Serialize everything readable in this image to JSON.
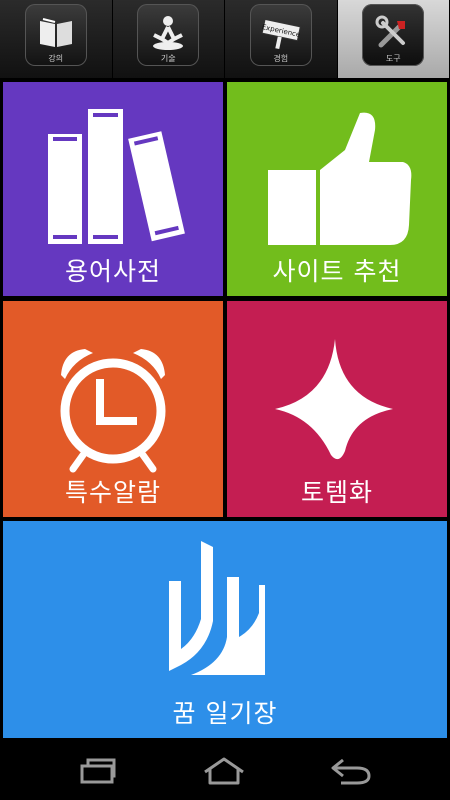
{
  "tabs": [
    {
      "label": "강의",
      "icon": "book-icon"
    },
    {
      "label": "기술",
      "icon": "meditation-icon"
    },
    {
      "label": "경험",
      "icon": "experience-sign-icon",
      "sign_text": "Experience"
    },
    {
      "label": "도구",
      "icon": "tools-icon",
      "active": true
    }
  ],
  "tiles": {
    "dictionary": {
      "label": "용어사전",
      "icon": "books-icon",
      "color": "#6538c0"
    },
    "sites": {
      "label": "사이트 추천",
      "icon": "thumbs-up-icon",
      "color": "#72bd1c"
    },
    "alarm": {
      "label": "특수알람",
      "icon": "alarm-clock-icon",
      "color": "#e25a28"
    },
    "totem": {
      "label": "토템화",
      "icon": "spinning-top-icon",
      "color": "#c41e52"
    },
    "diary": {
      "label": "꿈 일기장",
      "icon": "journal-logo-icon",
      "color": "#2d8fe9"
    }
  },
  "navbar": {
    "recent": "recent-apps-icon",
    "home": "home-icon",
    "back": "back-icon"
  }
}
